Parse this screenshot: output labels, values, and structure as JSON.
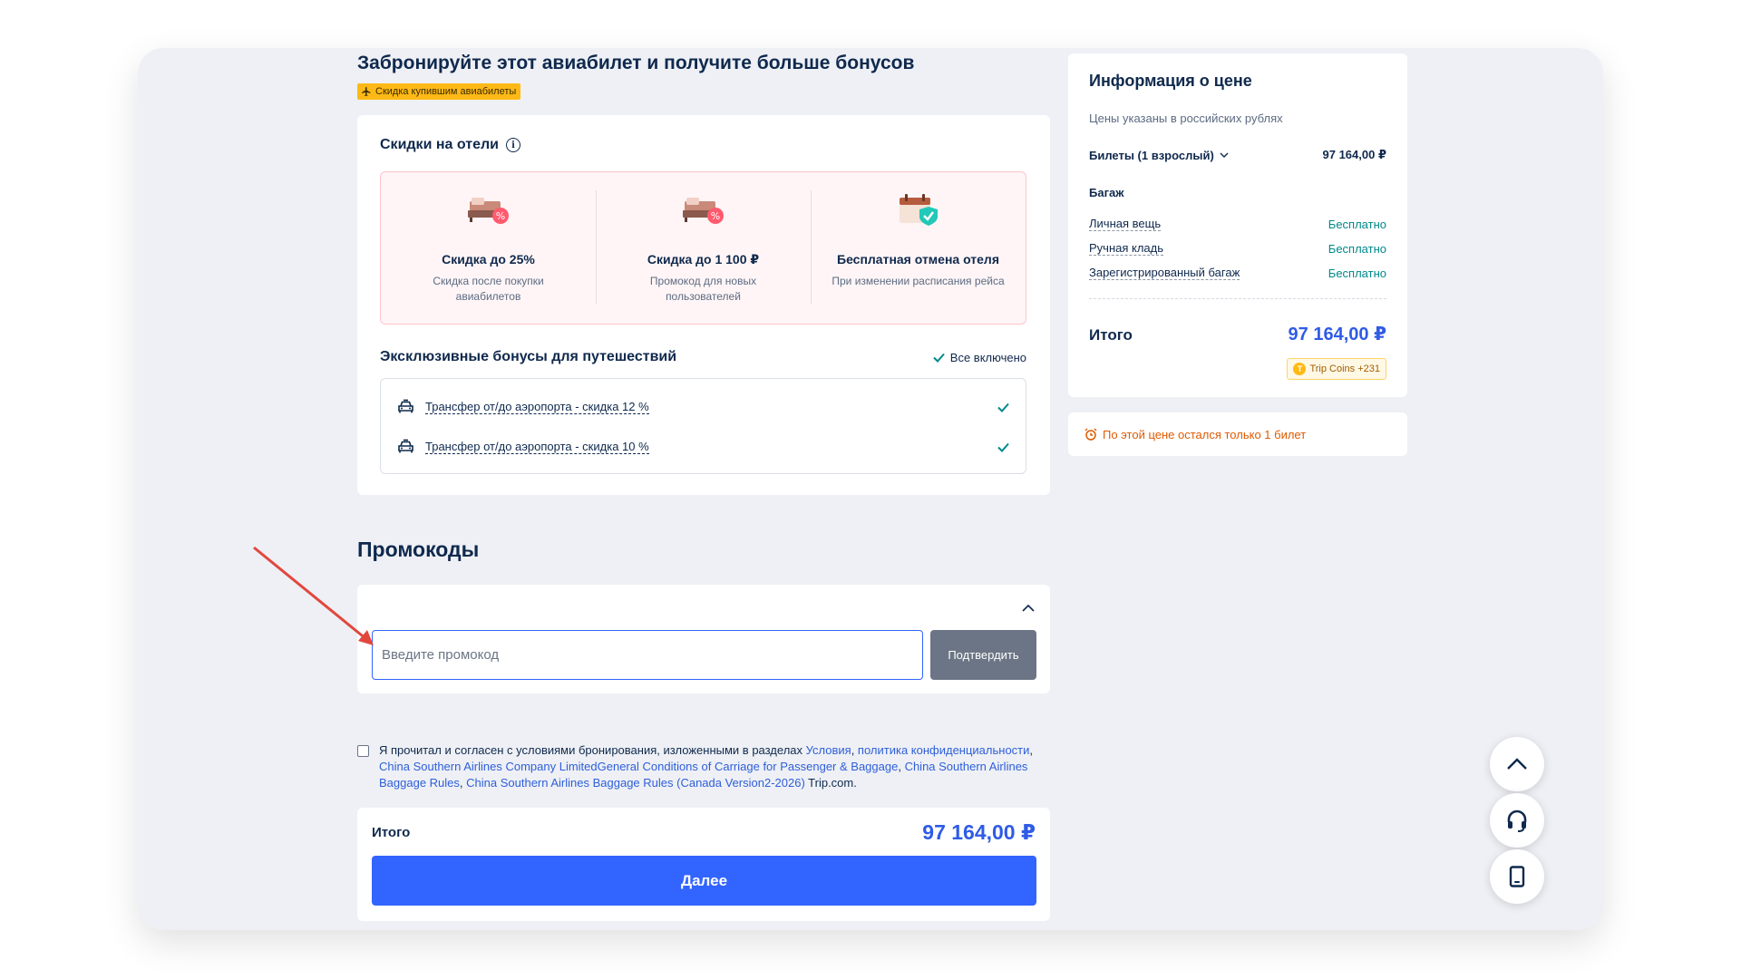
{
  "booking_promo": {
    "title": "Забронируйте этот авиабилет и получите больше бонусов",
    "tag": "Скидка купившим авиабилеты"
  },
  "hotels": {
    "title": "Скидки на отели",
    "perks": [
      {
        "title": "Скидка до 25%",
        "subtitle": "Скидка после покупки авиабилетов",
        "icon": "hotel-bed-discount-icon"
      },
      {
        "title": "Скидка до 1 100 ₽",
        "subtitle": "Промокод для новых пользователей",
        "icon": "hotel-bed-discount-icon"
      },
      {
        "title": "Бесплатная отмена отеля",
        "subtitle": "При изменении расписания рейса",
        "icon": "calendar-check-icon"
      }
    ]
  },
  "exclusive": {
    "title": "Эксклюзивные бонусы для путешествий",
    "all_included": "Все включено",
    "items": [
      {
        "label": "Трансфер от/до аэропорта - скидка 12 %"
      },
      {
        "label": "Трансфер от/до аэропорта - скидка 10 %"
      }
    ]
  },
  "promocodes": {
    "title": "Промокоды",
    "placeholder": "Введите промокод",
    "value": "",
    "confirm": "Подтвердить"
  },
  "terms": {
    "prefix": "Я прочитал и согласен с условиями бронирования, изложенными в разделах ",
    "link1": "Условия",
    "sep1": ", ",
    "link2": "политика конфиденциальности",
    "sep2": ", ",
    "link3": "China Southern Airlines Company LimitedGeneral Conditions of Carriage for Passenger & Baggage",
    "sep3": ", ",
    "link4": "China Southern Airlines Baggage Rules",
    "sep4": ", ",
    "link5": "China Southern Airlines Baggage Rules (Canada Version2-2026)",
    "suffix": " Trip.com.",
    "checked": false
  },
  "total": {
    "label": "Итого",
    "value": "97 164,00 ₽",
    "next": "Далее"
  },
  "price_info": {
    "title": "Информация о цене",
    "subtitle": "Цены указаны в российских рублях",
    "tickets_label": "Билеты (1 взрослый)",
    "tickets_value": "97 164,00 ₽",
    "baggage_title": "Багаж",
    "baggage": [
      {
        "label": "Личная вещь",
        "value": "Бесплатно"
      },
      {
        "label": "Ручная кладь",
        "value": "Бесплатно"
      },
      {
        "label": "Зарегистрированный багаж",
        "value": "Бесплатно"
      }
    ],
    "total_label": "Итого",
    "total_value": "97 164,00 ₽",
    "coins": "Trip Coins +231"
  },
  "alert": {
    "text": "По этой цене остался только 1 билет"
  },
  "colors": {
    "primary": "#3264ff",
    "price_blue": "#2f5be6",
    "free_green": "#00898a",
    "alert_orange": "#e05a00",
    "tag_yellow": "#ffb916",
    "annotation_red": "#e2473d"
  }
}
